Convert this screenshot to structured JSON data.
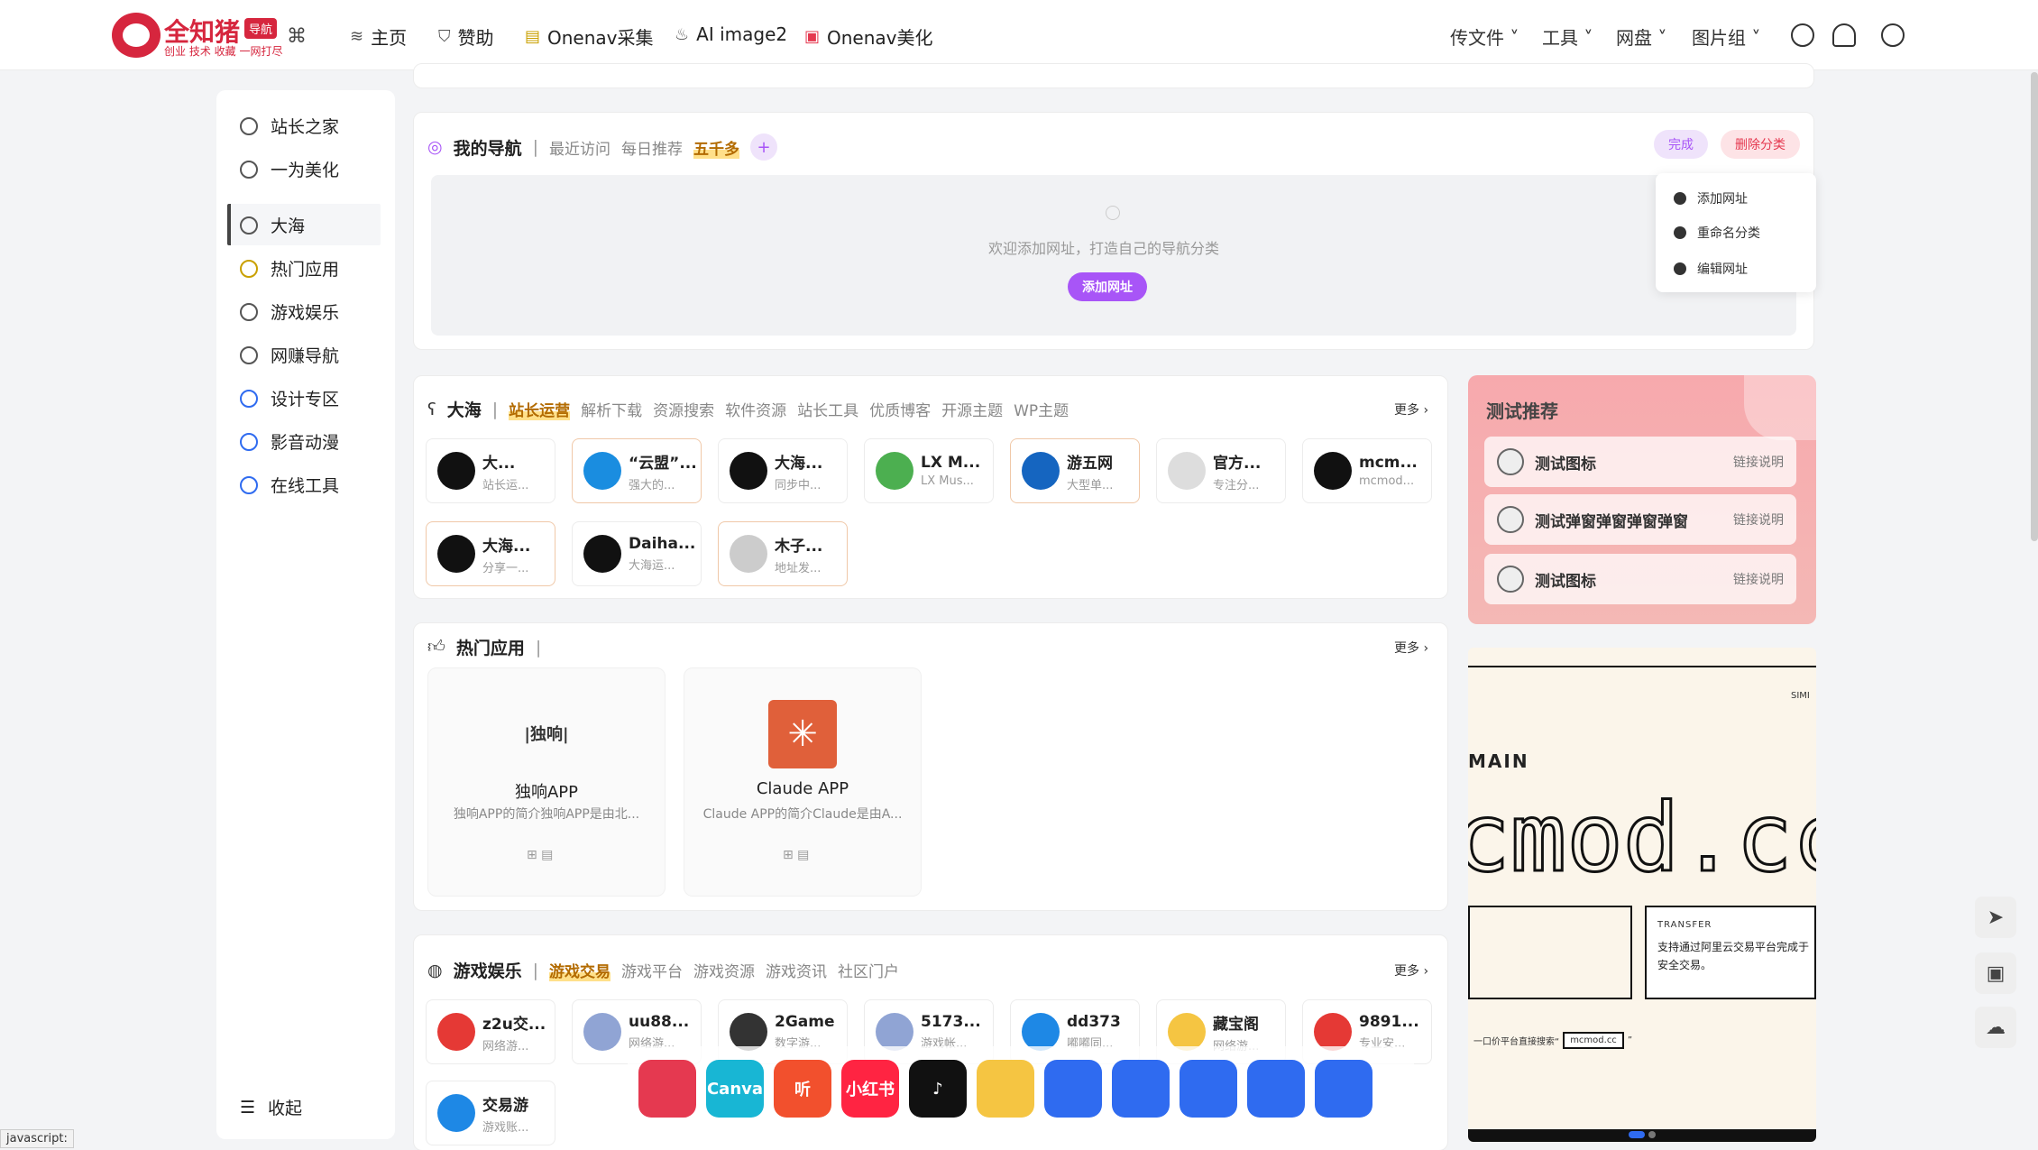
{
  "brand": {
    "name": "全知猪",
    "badge": "导航",
    "tagline": "创业 技术 收藏 一网打尽",
    "colors": {
      "brand": "#d6263e",
      "accent": "#a855f7"
    }
  },
  "topnav": [
    {
      "icon": "layers-icon",
      "label": "主页"
    },
    {
      "icon": "shield-icon",
      "label": "赞助"
    },
    {
      "icon": "note-icon",
      "label": "Onenav采集"
    },
    {
      "icon": "fire-icon",
      "label": "AI image2"
    },
    {
      "icon": "gift-icon",
      "label": "Onenav美化"
    }
  ],
  "topright": [
    "传文件",
    "工具",
    "网盘",
    "图片组"
  ],
  "sidebar": {
    "items": [
      "站长之家",
      "一为美化",
      "大海",
      "热门应用",
      "游戏娱乐",
      "网赚导航",
      "设计专区",
      "影音动漫",
      "在线工具"
    ],
    "active": "大海",
    "collapse": "收起"
  },
  "mynav": {
    "title": "我的导航",
    "tabs": [
      "最近访问",
      "每日推荐",
      "五千多"
    ],
    "active_tab": "五千多",
    "empty_text": "欢迎添加网址，打造自己的导航分类",
    "add_button": "添加网址",
    "done_button": "完成",
    "delete_button": "删除分类",
    "menu": [
      "添加网址",
      "重命名分类",
      "编辑网址"
    ]
  },
  "dahai": {
    "title": "大海",
    "tabs": [
      "站长运营",
      "解析下载",
      "资源搜索",
      "软件资源",
      "站长工具",
      "优质博客",
      "开源主题",
      "WP主题"
    ],
    "active_tab": "站长运营",
    "more": "更多",
    "cards": [
      {
        "name": "大...",
        "desc": "站长运...",
        "color": "#111",
        "gold": false
      },
      {
        "name": "“云盟”...",
        "desc": "强大的...",
        "color": "#1a8de0",
        "gold": true
      },
      {
        "name": "大海...",
        "desc": "同步中...",
        "color": "#111",
        "gold": false
      },
      {
        "name": "LX M...",
        "desc": "LX Mus...",
        "color": "#4caf50",
        "gold": false
      },
      {
        "name": "游五网",
        "desc": "大型单...",
        "color": "#1565c0",
        "gold": true
      },
      {
        "name": "官方...",
        "desc": "专注分...",
        "color": "#ddd",
        "gold": false
      },
      {
        "name": "mcm...",
        "desc": "mcmod...",
        "color": "#111",
        "gold": false
      },
      {
        "name": "大海...",
        "desc": "分享一...",
        "color": "#111",
        "gold": true
      },
      {
        "name": "Daiha...",
        "desc": "大海运...",
        "color": "#111",
        "gold": false
      },
      {
        "name": "木子...",
        "desc": "地址发...",
        "color": "#ccc",
        "gold": true
      }
    ]
  },
  "hotapps": {
    "title": "热门应用",
    "more": "更多",
    "apps": [
      {
        "name": "独响APP",
        "desc": "独响APP的简介独响APP是由北...",
        "logo": "|独响|",
        "color": "#fff"
      },
      {
        "name": "Claude APP",
        "desc": "Claude APP的简介Claude是由A...",
        "logo": "✳",
        "color": "#e0603a"
      }
    ]
  },
  "games": {
    "title": "游戏娱乐",
    "tabs": [
      "游戏交易",
      "游戏平台",
      "游戏资源",
      "游戏资讯",
      "社区门户"
    ],
    "active_tab": "游戏交易",
    "more": "更多",
    "cards": [
      {
        "name": "z2u交...",
        "desc": "网络游...",
        "color": "#e53935"
      },
      {
        "name": "uu88...",
        "desc": "网络游...",
        "color": "#90a4d4"
      },
      {
        "name": "2Game",
        "desc": "数字游...",
        "color": "#333"
      },
      {
        "name": "5173...",
        "desc": "游戏帐...",
        "color": "#90a4d4"
      },
      {
        "name": "dd373",
        "desc": "嘟嘟同...",
        "color": "#1e88e5"
      },
      {
        "name": "藏宝阁",
        "desc": "网络游...",
        "color": "#f5c542"
      },
      {
        "name": "9891...",
        "desc": "专业安...",
        "color": "#e53935"
      },
      {
        "name": "交易游",
        "desc": "游戏账...",
        "color": "#1e88e5"
      }
    ]
  },
  "recommend": {
    "title": "测试推荐",
    "items": [
      {
        "name": "测试图标",
        "link": "链接说明"
      },
      {
        "name": "测试弹窗弹窗弹窗弹窗",
        "link": "链接说明"
      },
      {
        "name": "测试图标",
        "link": "链接说明"
      }
    ]
  },
  "banner": {
    "brand": "SIMI",
    "main": "MAIN",
    "big": "cmod.cc",
    "transfer": "TRANSFER",
    "transfer_text": "支持通过阿里云交易平台完成于安全交易。",
    "search_text": "一口价平台直接搜索“",
    "search_tag": "mcmod.cc",
    "search_end": "”"
  },
  "dock": [
    {
      "name": "pocket-icon",
      "label": "",
      "color": "#e53950"
    },
    {
      "name": "canva-icon",
      "label": "Canva",
      "color": "#18b6d4"
    },
    {
      "name": "ting-icon",
      "label": "听",
      "color": "#f2502d"
    },
    {
      "name": "xiaohongshu-icon",
      "label": "小红书",
      "color": "#ff2442"
    },
    {
      "name": "tiktok-icon",
      "label": "♪",
      "color": "#111"
    },
    {
      "name": "mascot-icon",
      "label": "",
      "color": "#f5c542"
    },
    {
      "name": "like-icon",
      "label": "",
      "color": "#2f6bf0"
    },
    {
      "name": "chart-icon",
      "label": "",
      "color": "#2f6bf0"
    },
    {
      "name": "pinwheel-icon",
      "label": "",
      "color": "#2f6bf0"
    },
    {
      "name": "shrink-icon",
      "label": "",
      "color": "#2f6bf0"
    },
    {
      "name": "telegram-icon",
      "label": "",
      "color": "#2f6bf0"
    }
  ],
  "status": "javascript:"
}
